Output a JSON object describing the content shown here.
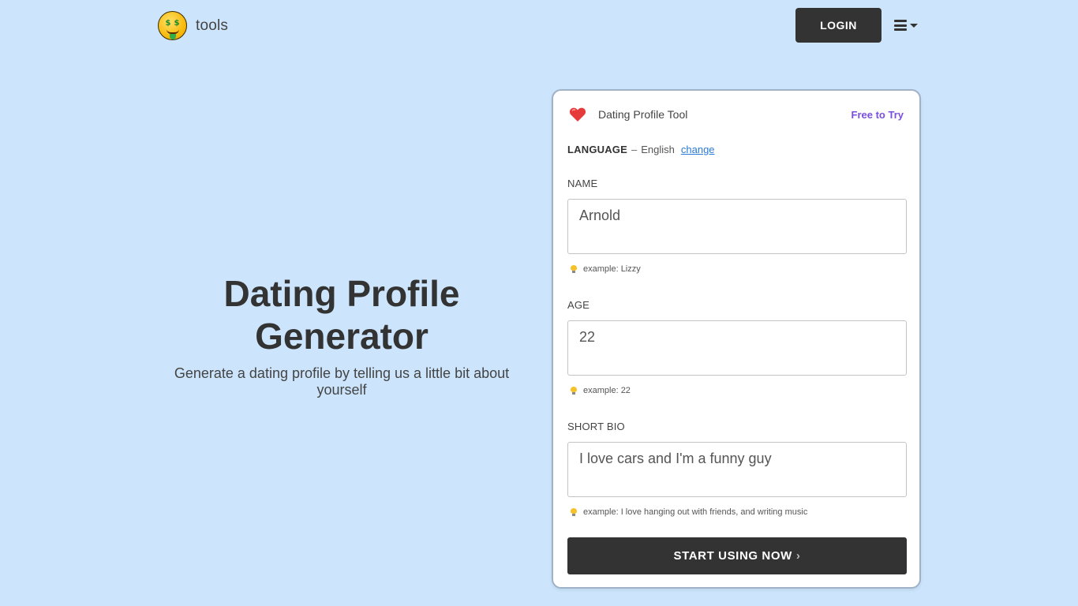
{
  "header": {
    "logo_text": "tools",
    "login_label": "LOGIN"
  },
  "hero": {
    "title_line1": "Dating Profile",
    "title_line2": "Generator",
    "subtitle": "Generate a dating profile by telling us a little bit about yourself"
  },
  "card": {
    "tool_name": "Dating Profile Tool",
    "badge": "Free to Try",
    "language_label": "LANGUAGE",
    "language_sep": "–",
    "language_value": "English",
    "language_change": "change",
    "fields": [
      {
        "label": "NAME",
        "value": "Arnold",
        "hint": "example: Lizzy"
      },
      {
        "label": "AGE",
        "value": "22",
        "hint": "example: 22"
      },
      {
        "label": "SHORT BIO",
        "value": "I love cars and I'm a funny guy",
        "hint": "example: I love hanging out with friends, and writing music"
      }
    ],
    "submit_label": "START USING NOW",
    "submit_chevron": "›"
  },
  "colors": {
    "background": "#cce5fc",
    "button_dark": "#333333",
    "badge": "#7a4fe0",
    "link": "#2a7ad8",
    "heart": "#e53b3b"
  },
  "icons": {
    "logo": "money-mouth-face-icon",
    "menu": "hamburger-menu-icon",
    "heart": "heart-icon",
    "hint": "lightbulb-icon"
  }
}
